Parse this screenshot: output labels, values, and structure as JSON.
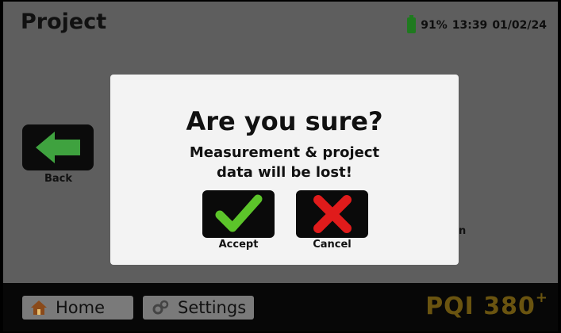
{
  "header": {
    "title": "Project",
    "battery": "91%",
    "time": "13:39",
    "date": "01/02/24"
  },
  "back": {
    "label": "Back"
  },
  "dialog": {
    "title": "Are you sure?",
    "message_line1": "Measurement & project",
    "message_line2": "data will be lost!",
    "accept_label": "Accept",
    "cancel_label": "Cancel"
  },
  "background_fragment": "n",
  "footer": {
    "home_label": "Home",
    "settings_label": "Settings",
    "logo_text": "PQI 380",
    "logo_sup": "+"
  },
  "icons": {
    "back": "arrow-left-icon",
    "accept": "check-icon",
    "cancel": "x-icon",
    "home": "home-icon",
    "settings": "gear-icon",
    "battery": "battery-icon"
  },
  "colors": {
    "accept_green": "#5cc42a",
    "cancel_red": "#e01b1b",
    "back_arrow_green": "#3fa23f",
    "logo_gold": "#6a5410"
  }
}
